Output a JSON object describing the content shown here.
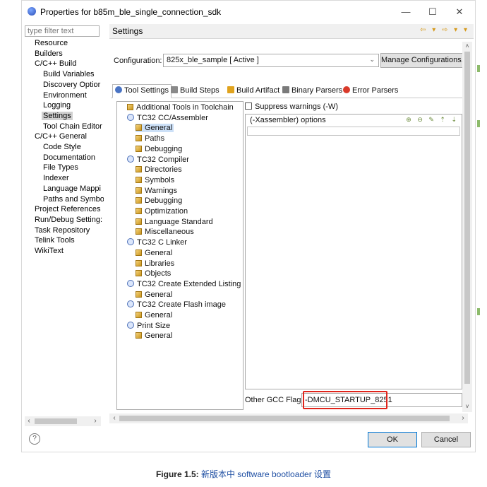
{
  "window": {
    "title": "Properties for b85m_ble_single_connection_sdk",
    "minimize_glyph": "—",
    "maximize_glyph": "☐",
    "close_glyph": "✕"
  },
  "left": {
    "filter_placeholder": "type filter text",
    "tree": [
      {
        "label": "Resource",
        "indent": 0
      },
      {
        "label": "Builders",
        "indent": 0
      },
      {
        "label": "C/C++ Build",
        "indent": 0
      },
      {
        "label": "Build Variables",
        "indent": 1
      },
      {
        "label": "Discovery Optior",
        "indent": 1
      },
      {
        "label": "Environment",
        "indent": 1
      },
      {
        "label": "Logging",
        "indent": 1
      },
      {
        "label": "Settings",
        "indent": 1,
        "selected": true
      },
      {
        "label": "Tool Chain Editor",
        "indent": 1
      },
      {
        "label": "C/C++ General",
        "indent": 0
      },
      {
        "label": "Code Style",
        "indent": 1
      },
      {
        "label": "Documentation",
        "indent": 1
      },
      {
        "label": "File Types",
        "indent": 1
      },
      {
        "label": "Indexer",
        "indent": 1
      },
      {
        "label": "Language Mappi",
        "indent": 1
      },
      {
        "label": "Paths and Symbo",
        "indent": 1
      },
      {
        "label": "Project References",
        "indent": 0
      },
      {
        "label": "Run/Debug Setting:",
        "indent": 0
      },
      {
        "label": "Task Repository",
        "indent": 0
      },
      {
        "label": "Telink Tools",
        "indent": 0
      },
      {
        "label": "WikiText",
        "indent": 0
      }
    ]
  },
  "right": {
    "title": "Settings",
    "nav_glyphs": "⇦ ▾ ⇨ ▾ ▾",
    "configuration_label": "Configuration:",
    "configuration_value": "825x_ble_sample  [ Active ]",
    "manage_button": "Manage Configurations...",
    "tabs": [
      {
        "label": "Tool Settings",
        "icon": "tool-settings-icon",
        "active": true
      },
      {
        "label": "Build Steps",
        "icon": "build-steps-icon"
      },
      {
        "label": "Build Artifact",
        "icon": "build-artifact-icon"
      },
      {
        "label": "Binary Parsers",
        "icon": "binary-parsers-icon"
      },
      {
        "label": "Error Parsers",
        "icon": "error-parsers-icon"
      }
    ],
    "tool_tree": [
      {
        "label": "Additional Tools in Toolchain",
        "type": "page",
        "indent": 0
      },
      {
        "label": "TC32 CC/Assembler",
        "type": "tool",
        "indent": 0
      },
      {
        "label": "General",
        "type": "page",
        "indent": 1,
        "selected": true
      },
      {
        "label": "Paths",
        "type": "page",
        "indent": 1
      },
      {
        "label": "Debugging",
        "type": "page",
        "indent": 1
      },
      {
        "label": "TC32 Compiler",
        "type": "tool",
        "indent": 0
      },
      {
        "label": "Directories",
        "type": "page",
        "indent": 1
      },
      {
        "label": "Symbols",
        "type": "page",
        "indent": 1
      },
      {
        "label": "Warnings",
        "type": "page",
        "indent": 1
      },
      {
        "label": "Debugging",
        "type": "page",
        "indent": 1
      },
      {
        "label": "Optimization",
        "type": "page",
        "indent": 1
      },
      {
        "label": "Language Standard",
        "type": "page",
        "indent": 1
      },
      {
        "label": "Miscellaneous",
        "type": "page",
        "indent": 1
      },
      {
        "label": "TC32 C Linker",
        "type": "tool",
        "indent": 0
      },
      {
        "label": "General",
        "type": "page",
        "indent": 1
      },
      {
        "label": "Libraries",
        "type": "page",
        "indent": 1
      },
      {
        "label": "Objects",
        "type": "page",
        "indent": 1
      },
      {
        "label": "TC32 Create Extended Listing",
        "type": "tool",
        "indent": 0
      },
      {
        "label": "General",
        "type": "page",
        "indent": 1
      },
      {
        "label": "TC32 Create Flash image",
        "type": "tool",
        "indent": 0
      },
      {
        "label": "General",
        "type": "page",
        "indent": 1
      },
      {
        "label": "Print Size",
        "type": "tool",
        "indent": 0
      },
      {
        "label": "General",
        "type": "page",
        "indent": 1
      }
    ],
    "suppress_warnings": "Suppress warnings (-W)",
    "xasm_options_label": "(-Xassembler) options",
    "xasm_icons": "⊕ ⊖ ✎ ⇡ ⇣",
    "other_gcc_flags_label": "Other GCC Flags",
    "other_gcc_flags_value": "-DMCU_STARTUP_8251"
  },
  "footer": {
    "help_glyph": "?",
    "ok": "OK",
    "cancel": "Cancel"
  },
  "caption": {
    "figure": "Figure 1.5:",
    "text": " 新版本中 software bootloader 设置"
  },
  "colors": {
    "highlight_border": "#e0251b",
    "selection": "#cce0f7",
    "caption_text": "#1f4fa3"
  }
}
